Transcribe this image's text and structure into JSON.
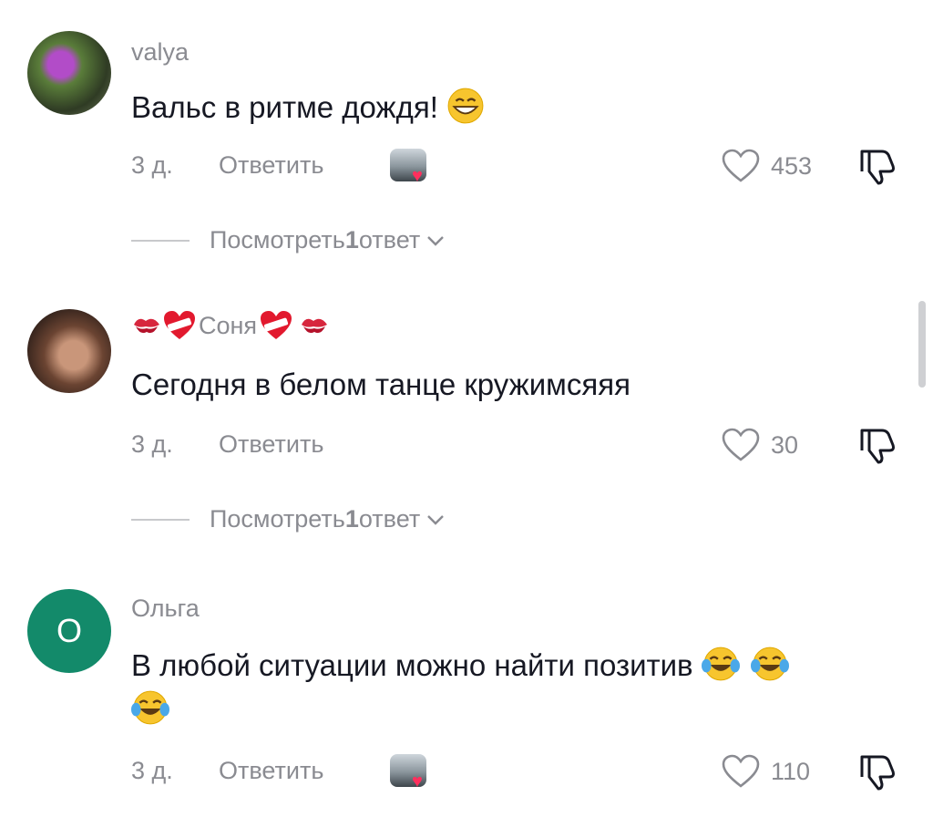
{
  "comments": [
    {
      "username": "valya",
      "text": "Вальс в ритме дождя!",
      "time": "3 д.",
      "reply_label": "Ответить",
      "likes": "453",
      "view_replies": {
        "prefix": "Посмотреть ",
        "count": "1",
        "suffix": " ответ"
      }
    },
    {
      "username": "Соня",
      "text": "Сегодня в белом танце кружимсяяя",
      "time": "3 д.",
      "reply_label": "Ответить",
      "likes": "30",
      "view_replies": {
        "prefix": "Посмотреть ",
        "count": "1",
        "suffix": " ответ"
      }
    },
    {
      "username": "Ольга",
      "avatar_letter": "О",
      "text": "В любой ситуации можно найти позитив",
      "time": "3 д.",
      "reply_label": "Ответить",
      "likes": "110"
    }
  ],
  "icons": {
    "like": "heart-outline-icon",
    "dislike": "thumbs-down-icon",
    "chevron": "chevron-down-icon"
  },
  "colors": {
    "muted_text": "#8a8b91",
    "text": "#161823",
    "olga_avatar_bg": "#138a6a",
    "creator_like_heart": "#ff2f5d"
  }
}
